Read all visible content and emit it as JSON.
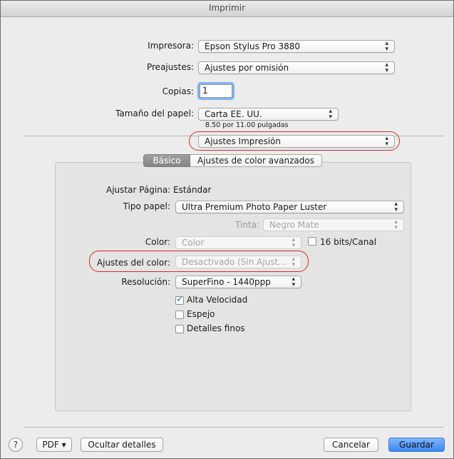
{
  "window": {
    "title": "Imprimir"
  },
  "printer": {
    "label": "Impresora:",
    "value": "Epson Stylus Pro 3880"
  },
  "presets": {
    "label": "Preajustes:",
    "value": "Ajustes por omisión"
  },
  "copies": {
    "label": "Copias:",
    "value": "1"
  },
  "paper_size": {
    "label": "Tamaño del papel:",
    "value": "Carta EE. UU.",
    "dimensions": "8.50 por 11.00 pulgadas"
  },
  "section_menu": {
    "value": "Ajustes Impresión"
  },
  "tabs": {
    "basic": "Básico",
    "advanced": "Ajustes de color avanzados",
    "selected": "Básico"
  },
  "page_setup": {
    "label": "Ajustar Página:",
    "value": "Estándar"
  },
  "paper_type": {
    "label": "Tipo papel:",
    "value": "Ultra Premium Photo Paper Luster"
  },
  "ink": {
    "label": "Tinta:",
    "value": "Negro Mate"
  },
  "color": {
    "label": "Color:",
    "value": "Color"
  },
  "bits": {
    "label": "16 bits/Canal",
    "checked": false
  },
  "color_settings": {
    "label": "Ajustes del color:",
    "value": "Desactivado (Sin Ajust..."
  },
  "resolution": {
    "label": "Resolución:",
    "value": "SuperFino - 1440ppp"
  },
  "options": [
    {
      "label": "Alta Velocidad",
      "checked": true
    },
    {
      "label": "Espejo",
      "checked": false
    },
    {
      "label": "Detalles finos",
      "checked": false
    }
  ],
  "footer": {
    "help": "?",
    "pdf": "PDF ▾",
    "hide_details": "Ocultar detalles",
    "cancel": "Cancelar",
    "save": "Guardar"
  },
  "icons": {
    "popup_arrows": "updown-arrows-icon",
    "check": "checkmark-icon",
    "help": "question-icon"
  },
  "colors": {
    "accent": "#3b87f1",
    "highlight_oval": "#d62a2a",
    "focus_ring": "#7fb2ef"
  }
}
